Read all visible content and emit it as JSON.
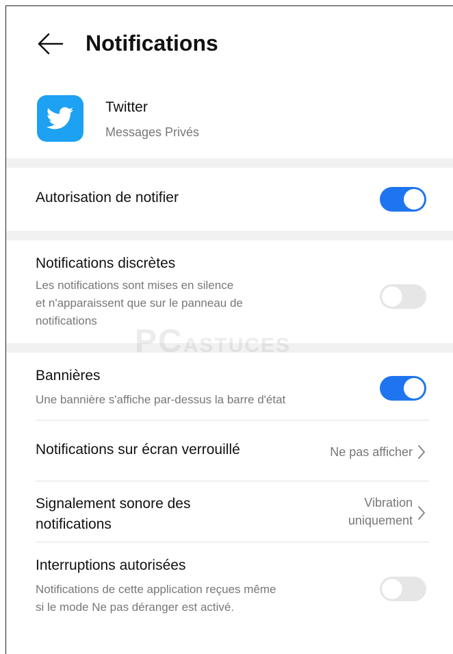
{
  "header": {
    "title": "Notifications"
  },
  "app": {
    "name": "Twitter",
    "subtitle": "Messages Privés"
  },
  "settings": {
    "allow": {
      "label": "Autorisation de notifier",
      "enabled": true
    },
    "discreet": {
      "label": "Notifications discrètes",
      "desc_lines": [
        "Les notifications sont mises en silence",
        "et n'apparaissent que sur le panneau de",
        "notifications"
      ],
      "enabled": false
    },
    "banners": {
      "label": "Bannières",
      "desc": "Une bannière s'affiche par-dessus la barre d'état",
      "enabled": true
    },
    "lockscreen": {
      "label": "Notifications sur écran verrouillé",
      "value": "Ne pas afficher"
    },
    "sound": {
      "label_lines": [
        "Signalement sonore des",
        "notifications"
      ],
      "value_lines": [
        "Vibration",
        "uniquement"
      ]
    },
    "interruptions": {
      "label": "Interruptions autorisées",
      "desc_lines": [
        "Notifications de cette application reçues même",
        "si le mode Ne pas déranger est activé."
      ],
      "enabled": false
    }
  },
  "watermark": {
    "big": "PC",
    "small": "ASTUCES"
  },
  "colors": {
    "accent": "#1f75f0",
    "twitter": "#1da1f2"
  },
  "icons": [
    "back-arrow-icon",
    "twitter-bird-icon",
    "chevron-right-icon"
  ]
}
